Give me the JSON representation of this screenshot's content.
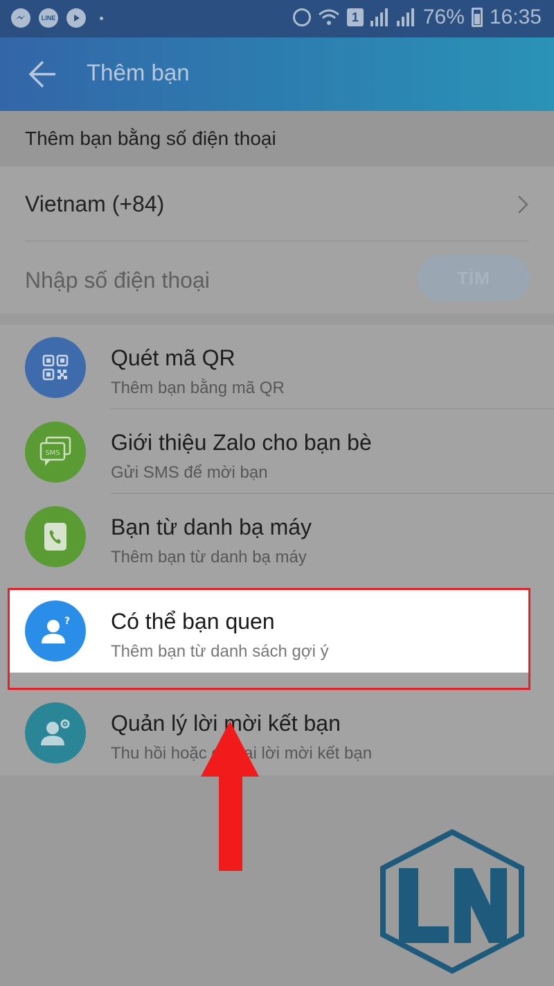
{
  "status_bar": {
    "left_icons": [
      "messenger-icon",
      "line-icon",
      "zalo-icon"
    ],
    "line_label": "LINE",
    "sim_label": "1",
    "battery": "76%",
    "time": "16:35"
  },
  "header": {
    "title": "Thêm bạn"
  },
  "phone_section": {
    "label": "Thêm bạn bằng số điện thoại",
    "country": "Vietnam (+84)",
    "input_placeholder": "Nhập số điện thoại",
    "search_button": "TÌM"
  },
  "options": [
    {
      "title": "Quét mã QR",
      "subtitle": "Thêm bạn bằng mã QR",
      "icon": "qr-code-icon",
      "color": "#3d6bab"
    },
    {
      "title": "Giới thiệu Zalo cho bạn bè",
      "subtitle": "Gửi SMS để mời bạn",
      "icon": "sms-icon",
      "color": "#5a9c33",
      "icon_label": "SMS"
    },
    {
      "title": "Bạn từ danh bạ máy",
      "subtitle": "Thêm bạn từ danh bạ máy",
      "icon": "phone-contacts-icon",
      "color": "#5a9c33"
    },
    {
      "title": "Có thể bạn quen",
      "subtitle": "Thêm bạn từ danh sách gợi ý",
      "icon": "user-question-icon",
      "color": "#2a8ee8"
    },
    {
      "title": "Quản lý lời mời kết bạn",
      "subtitle": "Thu hồi hoặc gửi lại lời mời kết bạn",
      "icon": "user-settings-icon",
      "color": "#2a8596"
    }
  ],
  "colors": {
    "highlight_frame": "#e0212b",
    "arrow": "#f21b1b",
    "logo": "#1d5a7c"
  },
  "logo": {
    "text": "LN"
  }
}
